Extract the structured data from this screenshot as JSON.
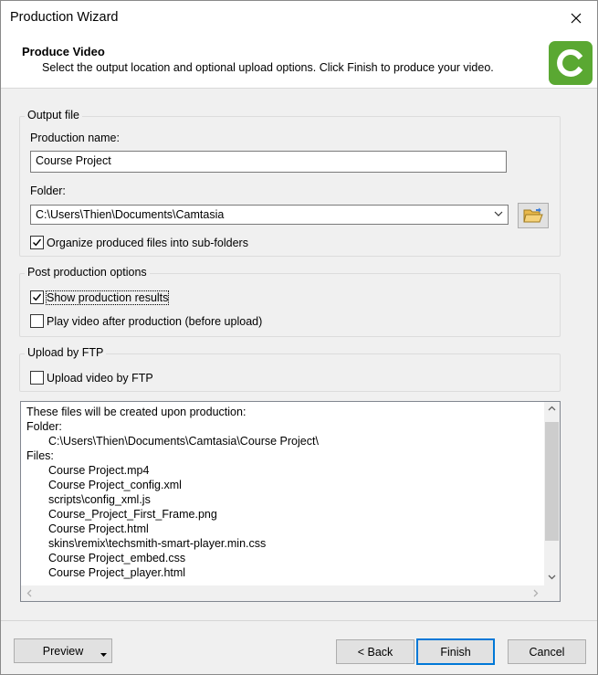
{
  "window": {
    "title": "Production Wizard"
  },
  "header": {
    "title": "Produce Video",
    "subtitle": "Select the output location and optional upload options. Click Finish to produce your video."
  },
  "output_file": {
    "group_label": "Output file",
    "name_label": "Production name:",
    "name_value": "Course Project",
    "folder_label": "Folder:",
    "folder_value": "C:\\Users\\Thien\\Documents\\Camtasia",
    "organize_label": "Organize produced files into sub-folders",
    "organize_checked": true
  },
  "post_production": {
    "group_label": "Post production options",
    "show_results_label": "Show production results",
    "show_results_checked": true,
    "play_after_label": "Play video after production (before upload)",
    "play_after_checked": false
  },
  "ftp": {
    "group_label": "Upload by FTP",
    "upload_label": "Upload video by FTP",
    "upload_checked": false
  },
  "files_panel": {
    "intro": "These files will be created upon production:",
    "folder_heading": "Folder:",
    "folder_path": "C:\\Users\\Thien\\Documents\\Camtasia\\Course Project\\",
    "files_heading": "Files:",
    "files": [
      "Course Project.mp4",
      "Course Project_config.xml",
      "scripts\\config_xml.js",
      "Course_Project_First_Frame.png",
      "Course Project.html",
      "skins\\remix\\techsmith-smart-player.min.css",
      "Course Project_embed.css",
      "Course Project_player.html"
    ]
  },
  "footer": {
    "preview_label": "Preview",
    "back_label": "< Back",
    "finish_label": "Finish",
    "cancel_label": "Cancel"
  },
  "colors": {
    "logo_green": "#5aa832",
    "focus_blue": "#0078d7"
  },
  "icons": [
    "close-icon",
    "camtasia-logo",
    "chevron-down-icon",
    "folder-open-icon",
    "checkmark-icon"
  ]
}
